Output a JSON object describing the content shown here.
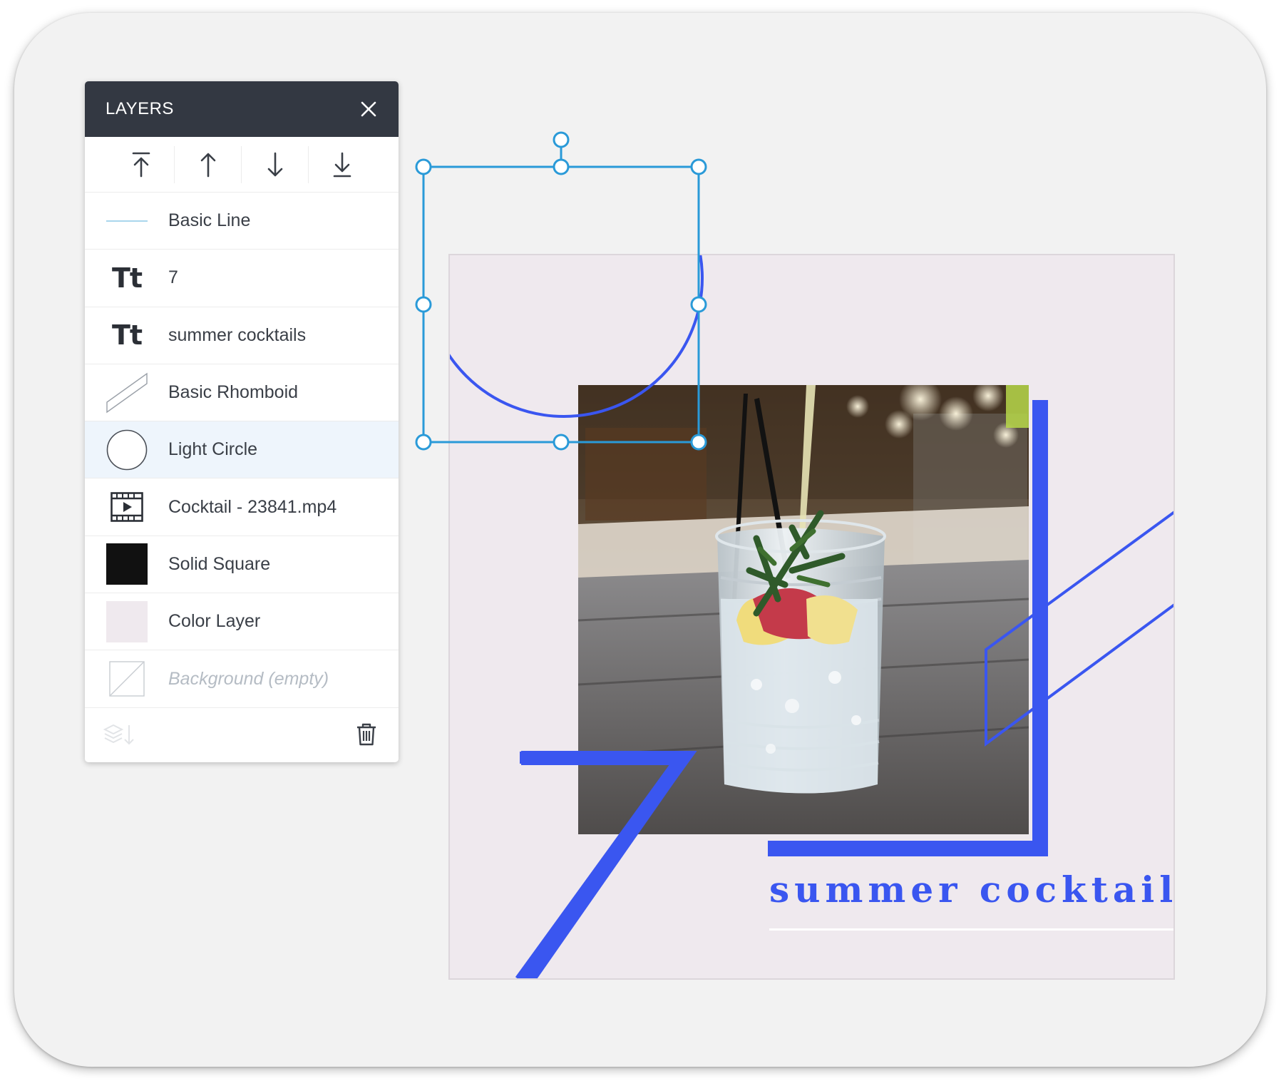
{
  "panel": {
    "title": "LAYERS",
    "close_icon": "close-icon",
    "order_buttons": [
      {
        "icon": "bring-to-front-icon"
      },
      {
        "icon": "bring-forward-icon"
      },
      {
        "icon": "send-backward-icon"
      },
      {
        "icon": "send-to-back-icon"
      }
    ],
    "layers": [
      {
        "label": "Basic Line",
        "thumb": "line-thumb-icon"
      },
      {
        "label": "7",
        "thumb": "text-icon",
        "thumb_text": "Tt"
      },
      {
        "label": "summer cocktails",
        "thumb": "text-icon",
        "thumb_text": "Tt"
      },
      {
        "label": "Basic Rhomboid",
        "thumb": "rhomboid-thumb-icon"
      },
      {
        "label": "Light Circle",
        "thumb": "circle-thumb-icon",
        "selected": true
      },
      {
        "label": "Cocktail - 23841.mp4",
        "thumb": "video-icon"
      },
      {
        "label": "Solid Square",
        "thumb": "square-thumb-icon"
      },
      {
        "label": "Color Layer",
        "thumb": "color-swatch-icon"
      },
      {
        "label": "Background (empty)",
        "thumb": "empty-thumb-icon",
        "empty": true
      }
    ],
    "footer": {
      "merge_icon": "merge-layers-icon",
      "delete_icon": "trash-icon"
    }
  },
  "canvas": {
    "headline": "summer cocktails",
    "accent_color": "#3a56f0",
    "artboard_color": "#efe9ee",
    "selection_color": "#2a9ad8"
  }
}
